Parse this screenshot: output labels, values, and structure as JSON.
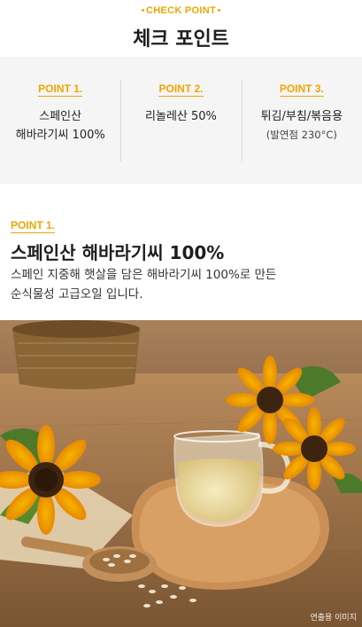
{
  "header": {
    "eyebrow": "CHECK POINT",
    "title": "체크 포인트"
  },
  "points": [
    {
      "label": "POINT 1.",
      "line1": "스페인산",
      "line2": "해바라기씨 100%",
      "sub": ""
    },
    {
      "label": "POINT 2.",
      "line1": "리놀레산 50%",
      "line2": "",
      "sub": ""
    },
    {
      "label": "POINT 3.",
      "line1": "튀김/부침/볶음용",
      "line2": "",
      "sub": "(발연점 230°C)"
    }
  ],
  "detail": {
    "label": "POINT 1.",
    "title": "스페인산 해바라기씨 100%",
    "desc_line1": "스페인 지중해 햇살을 담은 해바라기씨 100%로 만든",
    "desc_line2": "순식물성 고급오일 입니다."
  },
  "photo": {
    "caption": "연출용 이미지"
  },
  "colors": {
    "accent": "#f0a500",
    "panel_bg": "#f5f5f5",
    "title": "#1e1e1e"
  }
}
